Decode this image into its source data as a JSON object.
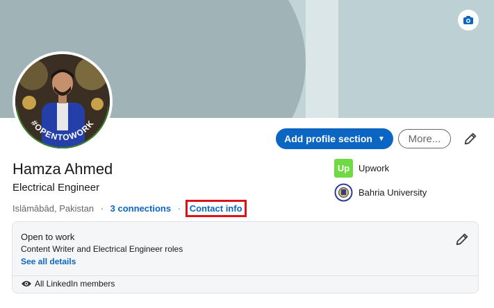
{
  "profile": {
    "name": "Hamza Ahmed",
    "headline": "Electrical Engineer",
    "location": "Islāmābād, Pakistan",
    "connections": "3 connections",
    "contact_info": "Contact info",
    "open_to_work_badge": "#OPENTOWORK"
  },
  "actions": {
    "add_section": "Add profile section",
    "more": "More..."
  },
  "organizations": [
    {
      "name": "Upwork",
      "logo_text": "Up",
      "icon": "upwork-logo"
    },
    {
      "name": "Bahria University",
      "icon": "bahria-university-logo"
    }
  ],
  "open_to_work": {
    "title": "Open to work",
    "roles": "Content Writer and Electrical Engineer roles",
    "see_details": "See all details",
    "visibility": "All LinkedIn members"
  },
  "icons": {
    "camera": "camera-icon",
    "pencil": "pencil-icon",
    "eye": "eye-icon",
    "caret": "caret-down-icon"
  },
  "colors": {
    "brand_blue": "#0a66c2",
    "highlight_red": "#e0101a",
    "upwork_green": "#6fda44",
    "open_to_work_green": "#3b7f2b"
  }
}
